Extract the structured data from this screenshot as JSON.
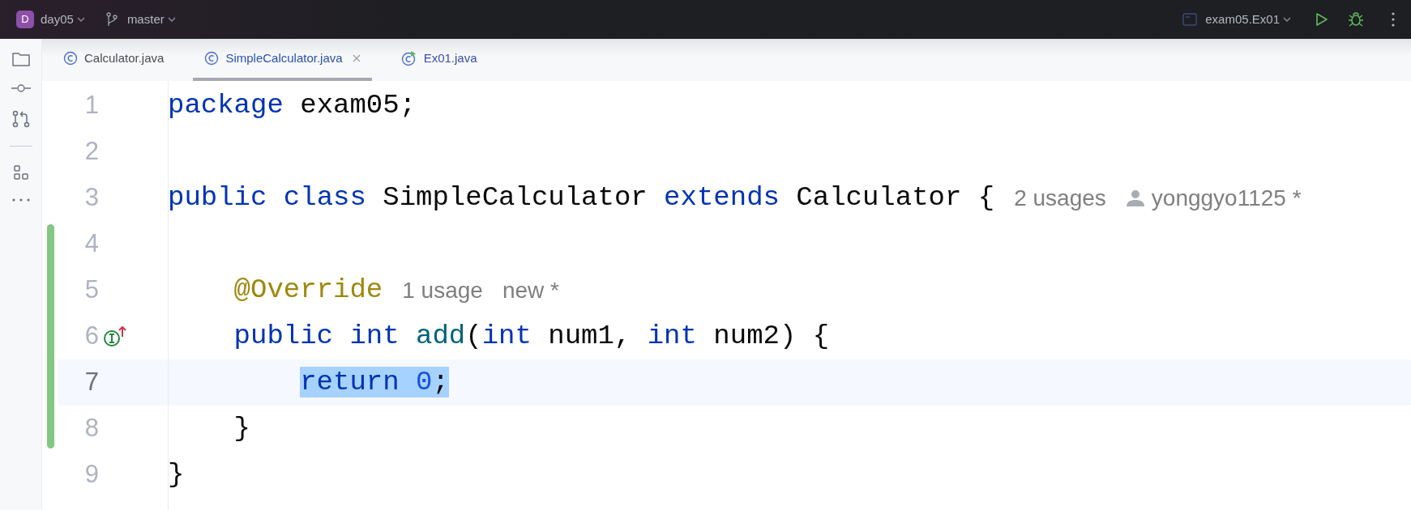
{
  "top_bar": {
    "project": {
      "initial": "D",
      "name": "day05"
    },
    "branch": "master",
    "run_config": "exam05.Ex01"
  },
  "tabs": [
    {
      "label": "Calculator.java",
      "kind": "class",
      "selected": false,
      "closable": false
    },
    {
      "label": "SimpleCalculator.java",
      "kind": "class",
      "selected": true,
      "closable": true
    },
    {
      "label": "Ex01.java",
      "kind": "runnable",
      "selected": false,
      "closable": false
    }
  ],
  "editor": {
    "lines": [
      {
        "number": "1",
        "current": false,
        "changed": false,
        "marker": false,
        "tokens": [
          {
            "text": "package",
            "kind": "keyword",
            "selected": false
          },
          {
            "text": " exam05;",
            "kind": "plain",
            "selected": false
          }
        ]
      },
      {
        "number": "2",
        "current": false,
        "changed": false,
        "marker": false
      },
      {
        "number": "3",
        "current": false,
        "changed": false,
        "marker": false,
        "tokens": [
          {
            "text": "public class",
            "kind": "keyword",
            "selected": false
          },
          {
            "text": " SimpleCalculator ",
            "kind": "plain",
            "selected": false
          },
          {
            "text": "extends",
            "kind": "keyword",
            "selected": false
          },
          {
            "text": " Calculator {",
            "kind": "plain",
            "selected": false
          }
        ],
        "hints": [
          {
            "text": "2 usages",
            "user_icon": false
          },
          {
            "text": "yonggyo1125 *",
            "user_icon": true
          }
        ],
        "children": [
          {
            "number": "4",
            "current": false,
            "changed": true,
            "marker": false
          },
          {
            "number": "5",
            "current": false,
            "changed": true,
            "marker": false,
            "tokens": [
              {
                "text": "@Override",
                "kind": "annotation",
                "selected": false
              }
            ],
            "hints": [
              {
                "text": "1 usage",
                "user_icon": false
              },
              {
                "text": "new *",
                "user_icon": false
              }
            ]
          },
          {
            "number": "6",
            "current": false,
            "changed": true,
            "marker": true,
            "tokens": [
              {
                "text": "public int ",
                "kind": "keyword",
                "selected": false
              },
              {
                "text": "add",
                "kind": "method",
                "selected": false
              },
              {
                "text": "(",
                "kind": "plain",
                "selected": false
              },
              {
                "text": "int",
                "kind": "keyword",
                "selected": false
              },
              {
                "text": " num1, ",
                "kind": "plain",
                "selected": false
              },
              {
                "text": "int",
                "kind": "keyword",
                "selected": false
              },
              {
                "text": " num2) {",
                "kind": "plain",
                "selected": false
              }
            ],
            "children": [
              {
                "number": "7",
                "current": true,
                "changed": true,
                "marker": false,
                "tokens": [
                  {
                    "text": "return ",
                    "kind": "keyword",
                    "selected": true
                  },
                  {
                    "text": "0",
                    "kind": "number",
                    "selected": true
                  },
                  {
                    "text": ";",
                    "kind": "plain",
                    "selected": true
                  }
                ]
              }
            ]
          },
          {
            "number": "8",
            "current": false,
            "changed": true,
            "marker": false,
            "tokens": [
              {
                "text": "}",
                "kind": "plain",
                "selected": false
              }
            ]
          }
        ]
      },
      {
        "number": "9",
        "current": false,
        "changed": false,
        "marker": false,
        "tokens": [
          {
            "text": "}",
            "kind": "plain",
            "selected": false
          }
        ]
      }
    ]
  }
}
